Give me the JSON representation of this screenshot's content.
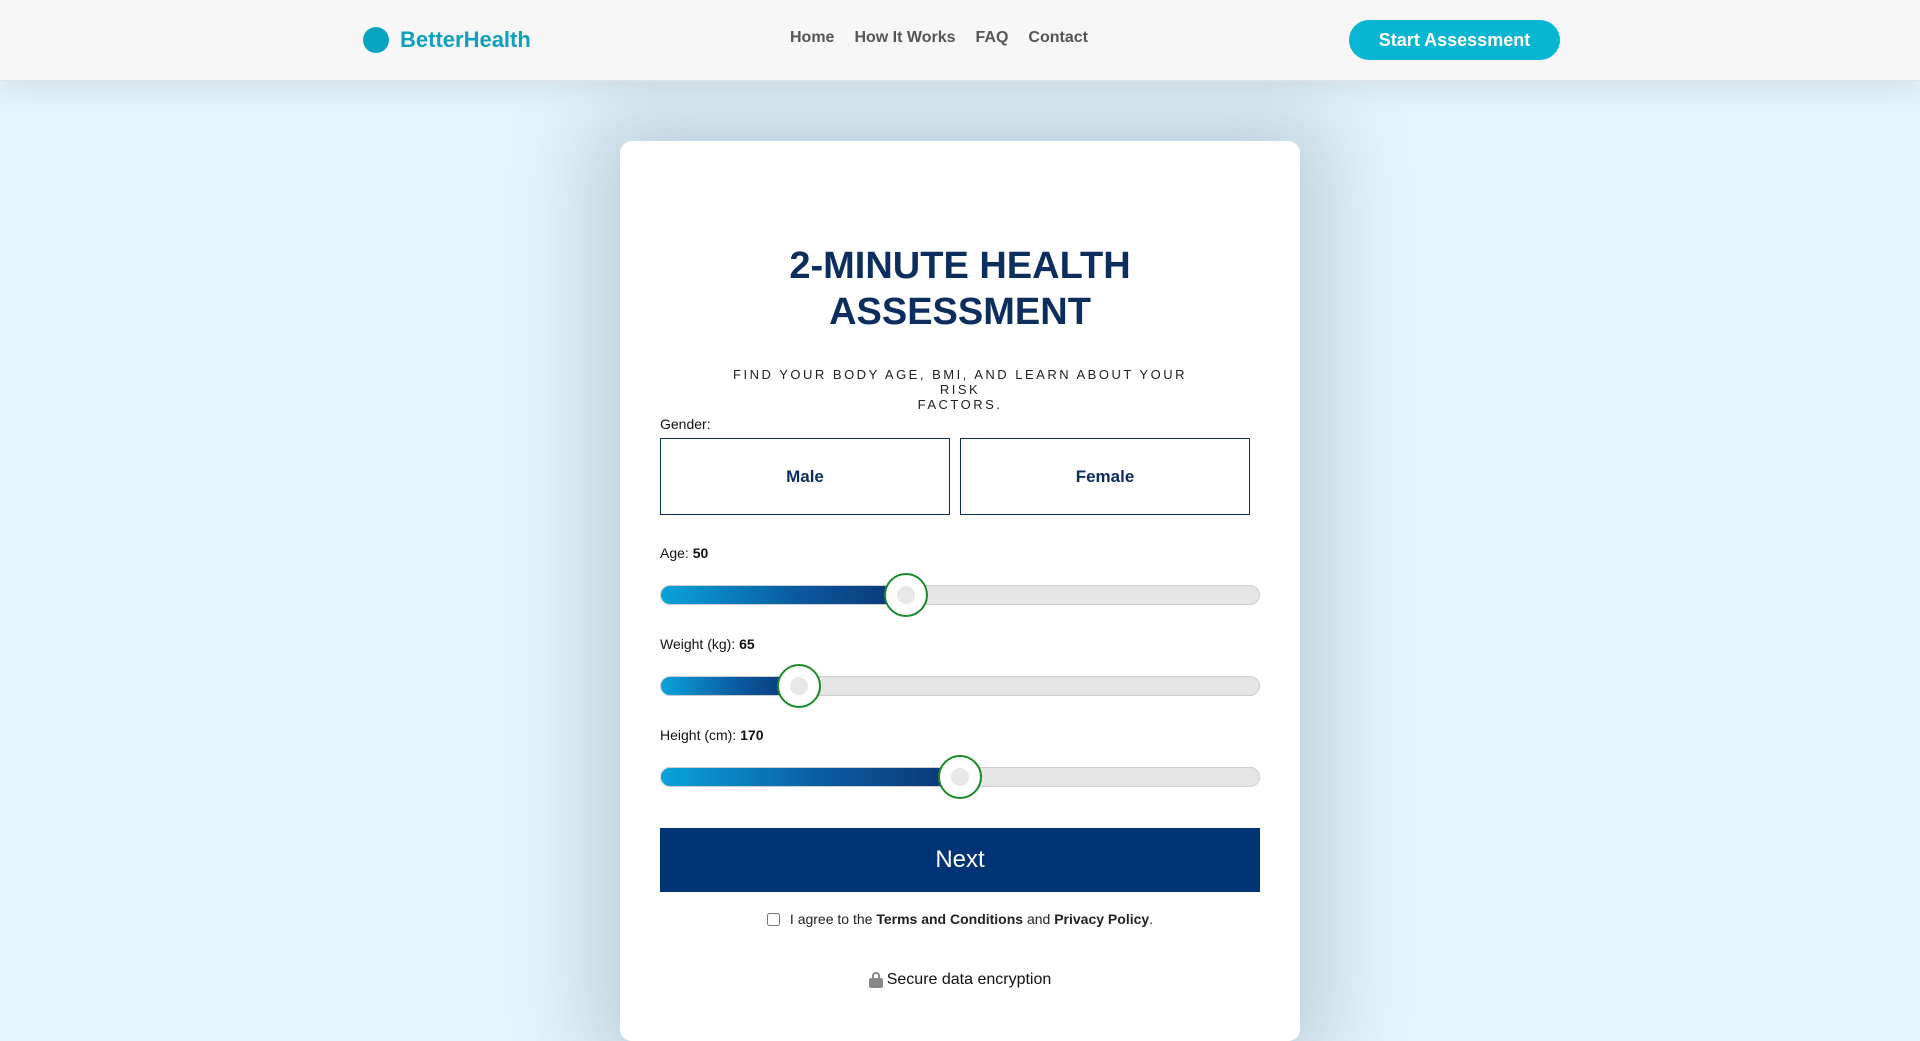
{
  "header": {
    "brand": "BetterHealth",
    "nav": [
      {
        "label": "Home"
      },
      {
        "label": "How It Works"
      },
      {
        "label": "FAQ"
      },
      {
        "label": "Contact"
      }
    ],
    "cta_label": "Start Assessment"
  },
  "assessment": {
    "title_line1": "2-MINUTE HEALTH",
    "title_line2": "ASSESSMENT",
    "subtitle_line1": "FIND YOUR BODY AGE, BMI, AND LEARN ABOUT YOUR RISK",
    "subtitle_line2": "FACTORS.",
    "gender_label": "Gender:",
    "gender_options": [
      {
        "label": "Male"
      },
      {
        "label": "Female"
      }
    ],
    "sliders": [
      {
        "label": "Age:",
        "value": "50",
        "fill_fraction": 0.41
      },
      {
        "label": "Weight (kg):",
        "value": "65",
        "fill_fraction": 0.23
      },
      {
        "label": "Height (cm):",
        "value": "170",
        "fill_fraction": 0.5
      }
    ],
    "next_label": "Next",
    "agree_prefix": "I agree to the",
    "terms_label": "Terms and Conditions",
    "agree_and": "and",
    "privacy_label": "Privacy Policy",
    "agree_suffix": ".",
    "secure_text": "Secure data encryption"
  },
  "colors": {
    "brand": "#10a0bf",
    "primary": "#003475",
    "cta": "#08b5d2",
    "thumb_border": "#1a8a2a"
  },
  "icons": {
    "brand": "circle-logo-icon",
    "secure": "lock-icon"
  }
}
